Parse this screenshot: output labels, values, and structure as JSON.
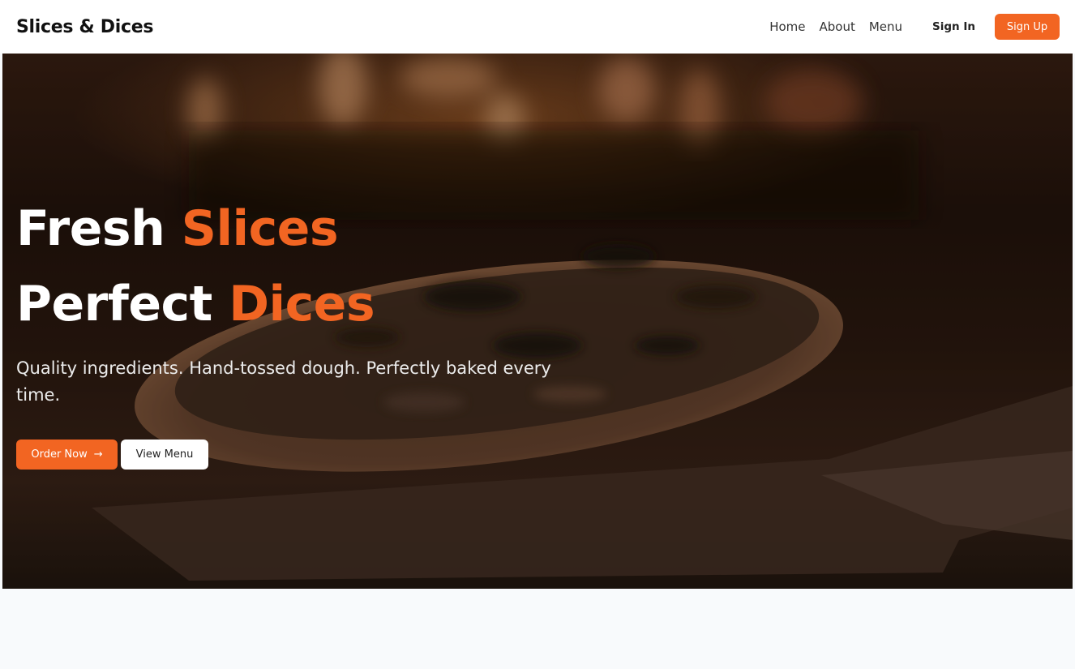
{
  "nav": {
    "brand": "Slices & Dices",
    "links": [
      "Home",
      "About",
      "Menu"
    ],
    "sign_in": "Sign In",
    "sign_up": "Sign Up"
  },
  "hero": {
    "line1_white": "Fresh ",
    "line1_accent": "Slices",
    "line2_white": "Perfect ",
    "line2_accent": "Dices",
    "subtitle": "Quality ingredients. Hand-tossed dough. Perfectly baked every time.",
    "order_button": "Order Now",
    "order_icon": "arrow-right-icon",
    "menu_button": "View Menu"
  },
  "colors": {
    "accent": "#f26522",
    "navbar_bg": "#ffffff",
    "page_bg": "#f8fafc"
  }
}
